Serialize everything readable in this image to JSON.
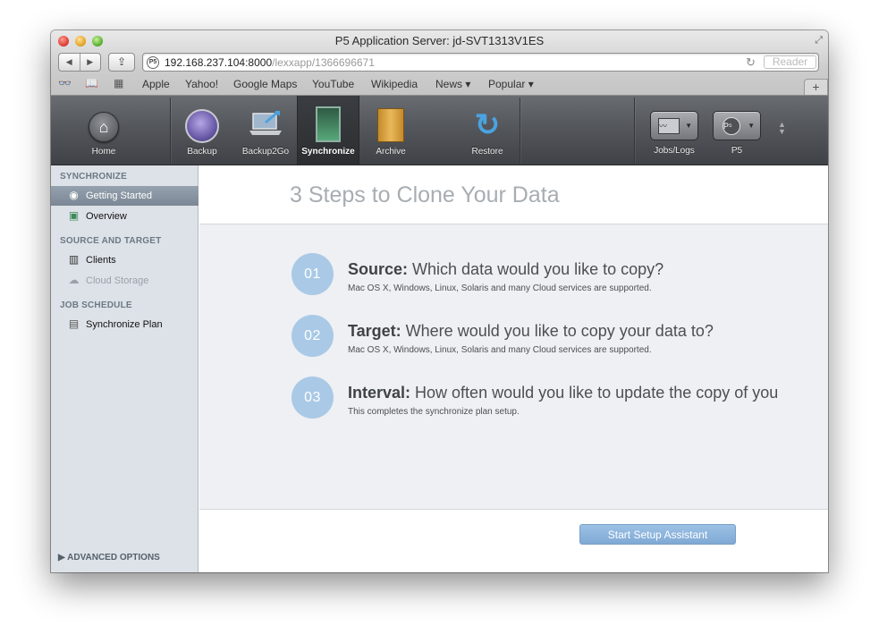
{
  "window": {
    "title": "P5 Application Server: jd-SVT1313V1ES",
    "url_host": "192.168.237.104:8000",
    "url_path": "/lexxapp/1366696671",
    "reader_label": "Reader"
  },
  "bookmarks": [
    "Apple",
    "Yahoo!",
    "Google Maps",
    "YouTube",
    "Wikipedia",
    "News ▾",
    "Popular ▾"
  ],
  "toolbar": {
    "home": "Home",
    "backup": "Backup",
    "backup2go": "Backup2Go",
    "synchronize": "Synchronize",
    "archive": "Archive",
    "restore": "Restore",
    "jobs_logs": "Jobs/Logs",
    "p5": "P5"
  },
  "sidebar": {
    "sections": [
      {
        "header": "SYNCHRONIZE",
        "items": [
          {
            "label": "Getting Started",
            "icon": "getting-started-icon",
            "selected": true
          },
          {
            "label": "Overview",
            "icon": "overview-icon"
          }
        ]
      },
      {
        "header": "SOURCE AND TARGET",
        "items": [
          {
            "label": "Clients",
            "icon": "clients-icon"
          },
          {
            "label": "Cloud Storage",
            "icon": "cloud-storage-icon",
            "disabled": true
          }
        ]
      },
      {
        "header": "JOB SCHEDULE",
        "items": [
          {
            "label": "Synchronize Plan",
            "icon": "plan-icon"
          }
        ]
      }
    ],
    "advanced_options": "ADVANCED OPTIONS"
  },
  "main": {
    "title": "3 Steps to Clone Your Data",
    "steps": [
      {
        "number": "01",
        "title_bold": "Source:",
        "title_rest": " Which data would you like to copy?",
        "desc": "Mac OS X, Windows, Linux, Solaris and many Cloud services are supported."
      },
      {
        "number": "02",
        "title_bold": "Target:",
        "title_rest": " Where would you like to copy your data to?",
        "desc": "Mac OS X, Windows, Linux, Solaris and many Cloud services are supported."
      },
      {
        "number": "03",
        "title_bold": "Interval:",
        "title_rest": " How often would you like to update the copy of you",
        "desc": "This completes the synchronize plan setup."
      }
    ],
    "setup_button": "Start Setup Assistant"
  },
  "colors": {
    "step_circle": "#a9c9e6",
    "setup_button": "#8bb4dc",
    "sidebar_selected": "#8894a1",
    "toolbar": "#54575c"
  }
}
